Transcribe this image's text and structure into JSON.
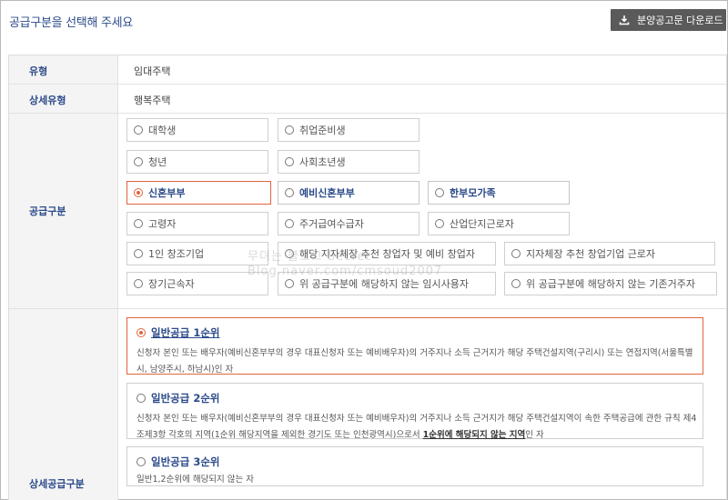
{
  "header": {
    "title": "공급구분을 선택해 주세요",
    "download_label": "분양공고문 다운로드"
  },
  "rows": {
    "type_label": "유형",
    "type_value": "임대주택",
    "subtype_label": "상세유형",
    "subtype_value": "행복주택",
    "supply_label": "공급구분",
    "detail_supply_label": "상세공급구분"
  },
  "supply_options": [
    {
      "label": "대학생",
      "selected": false
    },
    {
      "label": "취업준비생",
      "selected": false
    },
    {
      "label": "청년",
      "selected": false
    },
    {
      "label": "사회초년생",
      "selected": false
    },
    {
      "label": "신혼부부",
      "selected": true
    },
    {
      "label": "예비신혼부부",
      "selected": false
    },
    {
      "label": "한부모가족",
      "selected": false
    },
    {
      "label": "고령자",
      "selected": false
    },
    {
      "label": "주거급여수급자",
      "selected": false
    },
    {
      "label": "산업단지근로자",
      "selected": false
    },
    {
      "label": "1인 창조기업",
      "selected": false
    },
    {
      "label": "해당 지자체장 추천 창업자 및 예비 창업자",
      "selected": false
    },
    {
      "label": "지자체장 추천 창업기업 근로자",
      "selected": false
    },
    {
      "label": "장기근속자",
      "selected": false
    },
    {
      "label": "위 공급구분에 해당하지 않는 임시사용자",
      "selected": false
    },
    {
      "label": "위 공급구분에 해당하지 않는 기존거주자",
      "selected": false
    }
  ],
  "detail_options": [
    {
      "label": "일반공급 1순위",
      "selected": true,
      "desc": "신청자 본인 또는 배우자(예비신혼부부의 경우 대표신청자 또는 예비배우자)의 거주지나 소득 근거지가 해당 주택건설지역(구리시) 또는 연접지역(서울특별시, 남양주시, 하남시)인 자"
    },
    {
      "label": "일반공급 2순위",
      "selected": false,
      "desc_pre": "신청자 본인 또는 배우자(예비신혼부부의 경우 대표신청자 또는 예비배우자)의 거주지나 소득 근거지가 해당 주택건설지역이 속한 주택공급에 관한 규칙 제4조제3항 각호의 지역(1순위 해당지역을 제외한 경기도 또는 인천광역시)으로서 ",
      "desc_u": "1순위에 해당되지 않는 지역",
      "desc_post": "인 자"
    },
    {
      "label": "일반공급 3순위",
      "selected": false,
      "desc": "일반1,2순위에 해당되지 않는 자"
    }
  ],
  "watermark": {
    "line1": "무뎌는 블로그 Secret",
    "line2": "Blog.naver.com/cmsoud2007"
  },
  "colors": {
    "accent_navy": "#2b4a8a",
    "selected_orange": "#e0643e",
    "button_gray": "#5a5a5a"
  }
}
